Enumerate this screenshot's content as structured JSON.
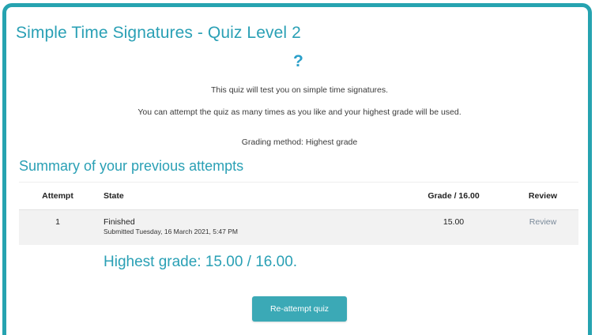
{
  "quiz": {
    "title": "Simple Time Signatures - Quiz Level 2",
    "help_icon": "?",
    "intro_line1": "This quiz will test you on simple time signatures.",
    "intro_line2": "You can attempt the quiz as many times as you like and your highest grade will be used.",
    "grading_method": "Grading method: Highest grade"
  },
  "summary": {
    "heading": "Summary of your previous attempts",
    "columns": {
      "attempt": "Attempt",
      "state": "State",
      "grade": "Grade / 16.00",
      "review": "Review"
    },
    "rows": [
      {
        "attempt": "1",
        "state": "Finished",
        "submitted": "Submitted Tuesday, 16 March 2021, 5:47 PM",
        "grade": "15.00",
        "review": "Review"
      }
    ]
  },
  "highest_grade": "Highest grade: 15.00 / 16.00.",
  "reattempt_button": "Re-attempt quiz",
  "colors": {
    "accent": "#26a3b0",
    "heading": "#2aa0b5",
    "button": "#3ba9b6"
  },
  "icons": {
    "help": "question-mark-icon"
  }
}
